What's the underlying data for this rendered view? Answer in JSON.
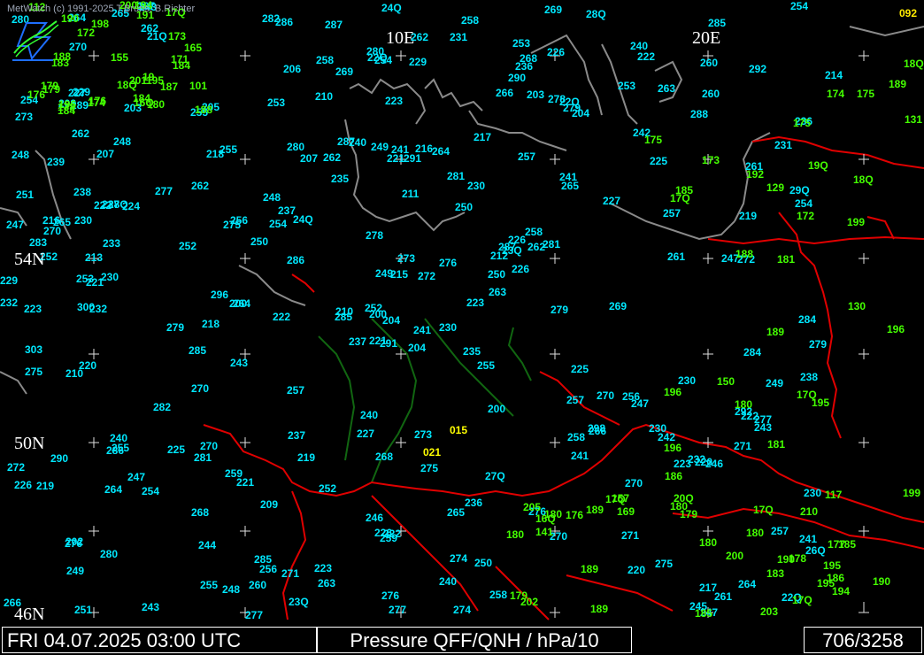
{
  "app": {
    "copyright": "MetWatch  (c) 1991-2025 T.Bruns, B.Richter",
    "corner_value": "092"
  },
  "grid_labels": [
    {
      "id": "lon-10e",
      "text": "10E"
    },
    {
      "id": "lon-20e",
      "text": "20E"
    },
    {
      "id": "lat-54n",
      "text": "54N"
    },
    {
      "id": "lat-50n",
      "text": "50N"
    },
    {
      "id": "lat-46n",
      "text": "46N"
    }
  ],
  "footer": {
    "datetime": "FRI 04.07.2025 03:00 UTC",
    "title": "Pressure QFF/QNH / hPa/10",
    "count": "706/3258"
  },
  "colors": {
    "cyan": "#00e8ff",
    "green": "#44ff00",
    "yellow": "#ffff00",
    "border": "#e00000",
    "coast": "#8a8a8a",
    "river": "#116611"
  },
  "station_values": {
    "cyan": [
      "204",
      "207",
      "200",
      "202",
      "212",
      "221",
      "226",
      "216",
      "22Q",
      "223",
      "21Q",
      "22Q",
      "230",
      "236",
      "237",
      "241",
      "243",
      "249",
      "250",
      "247",
      "24Q",
      "249",
      "244",
      "241",
      "23Q",
      "247",
      "248",
      "254",
      "252",
      "257",
      "254",
      "252",
      "246",
      "249",
      "255",
      "253",
      "259",
      "261",
      "257",
      "256",
      "258",
      "254",
      "252",
      "241",
      "248",
      "247",
      "250",
      "251",
      "259",
      "263",
      "264",
      "261",
      "254",
      "266",
      "270",
      "268",
      "262",
      "264",
      "265",
      "260",
      "262",
      "264",
      "265",
      "262",
      "263",
      "267",
      "268",
      "269",
      "273",
      "272",
      "268",
      "271",
      "270",
      "275",
      "276",
      "270",
      "277",
      "275",
      "278",
      "274",
      "276",
      "280",
      "279",
      "277",
      "276",
      "272",
      "273",
      "275",
      "274",
      "276",
      "280",
      "279",
      "281",
      "270",
      "272",
      "271",
      "270",
      "277",
      "278",
      "279",
      "279",
      "282",
      "284",
      "283",
      "282",
      "281",
      "285",
      "287",
      "288",
      "286",
      "284",
      "289",
      "291",
      "285",
      "286",
      "290",
      "291",
      "292",
      "287",
      "287",
      "286",
      "285",
      "281",
      "280",
      "269",
      "270",
      "264",
      "263",
      "261",
      "262",
      "255",
      "258",
      "256",
      "253",
      "249",
      "242",
      "243",
      "240",
      "238",
      "237",
      "235",
      "233",
      "232",
      "230",
      "226",
      "229",
      "223",
      "220",
      "226",
      "22Q",
      "219",
      "218",
      "216",
      "23Q",
      "230",
      "231",
      "223",
      "211",
      "218",
      "217",
      "200",
      "229",
      "232",
      "24Q",
      "236",
      "238",
      "240",
      "241",
      "243",
      "247",
      "246",
      "250",
      "251",
      "253",
      "258",
      "260",
      "266",
      "258",
      "248",
      "237",
      "239",
      "241",
      "240",
      "230",
      "227",
      "224",
      "222",
      "213",
      "209",
      "204",
      "222",
      "219",
      "221",
      "225",
      "226",
      "222",
      "232",
      "240",
      "230",
      "225",
      "221",
      "240",
      "235",
      "229",
      "227",
      "223",
      "221",
      "226",
      "227",
      "222",
      "230",
      "231",
      "250",
      "243",
      "247",
      "252",
      "254",
      "255",
      "257",
      "253",
      "258",
      "264",
      "266",
      "257",
      "255",
      "270",
      "262",
      "260",
      "265",
      "271",
      "269",
      "273",
      "277",
      "280",
      "285",
      "290",
      "296",
      "300",
      "303",
      "298",
      "29Q",
      "292",
      "28Q",
      "28Q",
      "275",
      "27Q",
      "26Q",
      "255",
      "265",
      "257",
      "262",
      "256",
      "254",
      "248",
      "245",
      "242",
      "237",
      "236",
      "230",
      "223",
      "220",
      "225",
      "219",
      "214",
      "215",
      "210",
      "207",
      "205",
      "203",
      "200",
      "206",
      "204",
      "208",
      "220",
      "222",
      "210",
      "217",
      "210",
      "203"
    ],
    "green": [
      "196",
      "188",
      "205",
      "195",
      "179",
      "17Q",
      "180",
      "18Q",
      "190",
      "180",
      "195",
      "199",
      "196",
      "188",
      "17Q",
      "18Q",
      "16Q",
      "16Q",
      "175",
      "176",
      "194",
      "189",
      "191",
      "210",
      "20Q",
      "194",
      "189",
      "17Q",
      "176",
      "200",
      "199",
      "190",
      "180",
      "192",
      "200",
      "189",
      "188",
      "184",
      "189",
      "18Q",
      "17Q",
      "180",
      "17Q",
      "174",
      "176",
      "181",
      "187",
      "186",
      "196",
      "196",
      "203",
      "195",
      "179",
      "180",
      "172",
      "184",
      "169",
      "185",
      "201",
      "195",
      "174",
      "171",
      "177",
      "175",
      "173",
      "178",
      "186",
      "165",
      "185",
      "19Q",
      "198",
      "180",
      "183",
      "180",
      "179",
      "131",
      "112",
      "117",
      "129",
      "101",
      "141",
      "150",
      "155",
      "157",
      "130",
      "183",
      "190",
      "173",
      "172",
      "17Q",
      "175",
      "178",
      "179",
      "181",
      "184",
      "185",
      "189",
      "19",
      "202"
    ],
    "yellow": [
      "015",
      "021"
    ]
  }
}
